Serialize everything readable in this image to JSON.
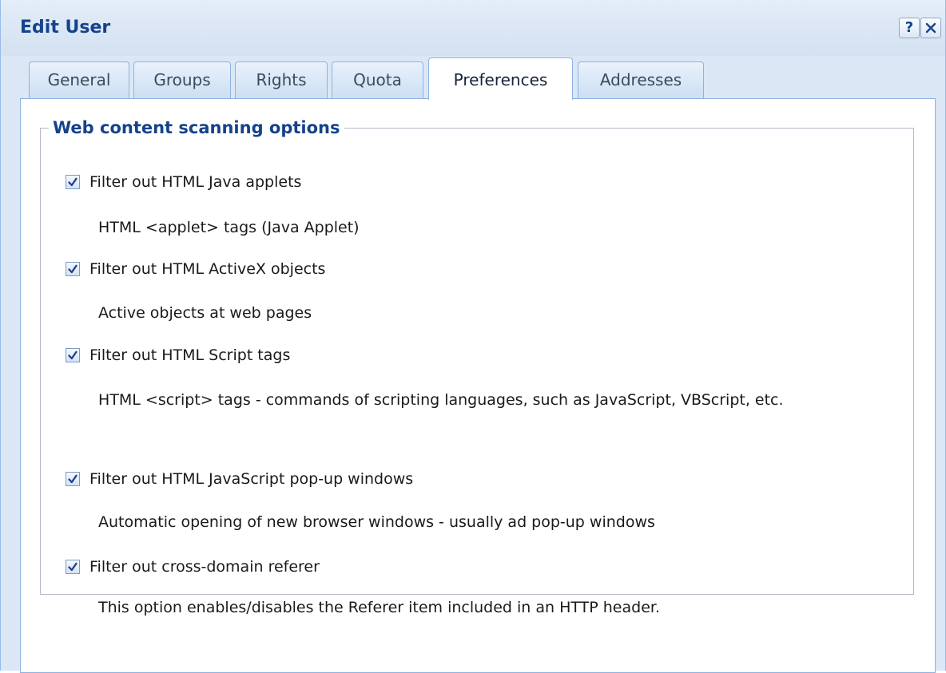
{
  "window": {
    "title": "Edit User",
    "help_label": "?"
  },
  "tabs": [
    {
      "label": "General",
      "active": false
    },
    {
      "label": "Groups",
      "active": false
    },
    {
      "label": "Rights",
      "active": false
    },
    {
      "label": "Quota",
      "active": false
    },
    {
      "label": "Preferences",
      "active": true
    },
    {
      "label": "Addresses",
      "active": false
    }
  ],
  "section": {
    "title": "Web content scanning options",
    "options": [
      {
        "label": "Filter out HTML Java applets",
        "checked": true,
        "description": "HTML <applet> tags (Java Applet)"
      },
      {
        "label": "Filter out HTML ActiveX objects",
        "checked": true,
        "description": "Active objects at web pages"
      },
      {
        "label": "Filter out HTML Script tags",
        "checked": true,
        "description": "HTML <script> tags - commands of scripting languages, such as JavaScript, VBScript, etc."
      },
      {
        "label": "Filter out HTML JavaScript pop-up windows",
        "checked": true,
        "description": "Automatic opening of new browser windows - usually ad pop-up windows"
      },
      {
        "label": "Filter out cross-domain referer",
        "checked": true,
        "description": "This option enables/disables the Referer item included in an HTTP header."
      }
    ]
  },
  "colors": {
    "title_text": "#15428b",
    "tab_border": "#8db2e3",
    "window_bg": "#dbe7f5",
    "checkmark": "#1f3f8f"
  },
  "icons": {
    "help": "help-icon",
    "close": "close-icon",
    "checkbox": "checkbox-checked-icon"
  }
}
